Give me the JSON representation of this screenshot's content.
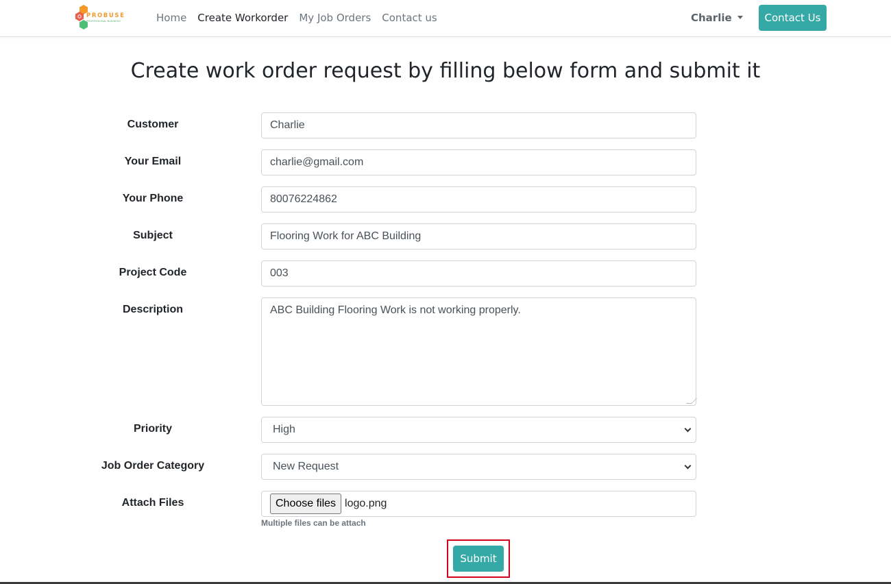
{
  "brand": {
    "name": "PROBUSE",
    "tagline": "PROFESSIONAL BUSINESS"
  },
  "nav": {
    "links": [
      {
        "label": "Home"
      },
      {
        "label": "Create Workorder"
      },
      {
        "label": "My Job Orders"
      },
      {
        "label": "Contact us"
      }
    ],
    "user": "Charlie",
    "contact_button": "Contact Us"
  },
  "page": {
    "title": "Create work order request by filling below form and submit it"
  },
  "form": {
    "customer": {
      "label": "Customer",
      "value": "Charlie"
    },
    "email": {
      "label": "Your Email",
      "value": "charlie@gmail.com"
    },
    "phone": {
      "label": "Your Phone",
      "value": "80076224862"
    },
    "subject": {
      "label": "Subject",
      "value": "Flooring Work for ABC Building"
    },
    "project_code": {
      "label": "Project Code",
      "value": "003"
    },
    "description": {
      "label": "Description",
      "value": "ABC Building Flooring Work is not working properly."
    },
    "priority": {
      "label": "Priority",
      "value": "High"
    },
    "category": {
      "label": "Job Order Category",
      "value": "New Request"
    },
    "attach": {
      "label": "Attach Files",
      "button": "Choose files",
      "file_name": "logo.png",
      "hint": "Multiple files can be attach"
    },
    "submit": "Submit"
  },
  "colors": {
    "accent": "#35a9a6",
    "highlight": "#d0021b"
  }
}
